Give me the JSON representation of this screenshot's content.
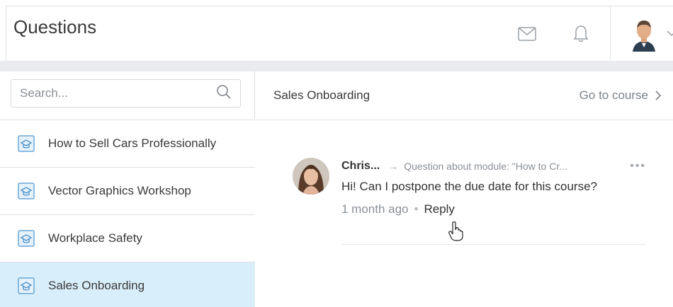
{
  "header": {
    "title": "Questions"
  },
  "search": {
    "placeholder": "Search..."
  },
  "courses": [
    {
      "label": "How to Sell Cars Professionally"
    },
    {
      "label": "Vector Graphics Workshop"
    },
    {
      "label": "Workplace Safety"
    },
    {
      "label": "Sales Onboarding"
    }
  ],
  "main": {
    "course_title": "Sales Onboarding",
    "go_to_course": "Go to course"
  },
  "post": {
    "author": "Chris...",
    "context": "Question about module: \"How to Cr...",
    "text": "Hi! Can I postpone the due date for this course?",
    "time": "1 month ago",
    "reply": "Reply"
  },
  "colors": {
    "active_row": "#d9eefb",
    "accent_icon": "#4a90c8"
  }
}
